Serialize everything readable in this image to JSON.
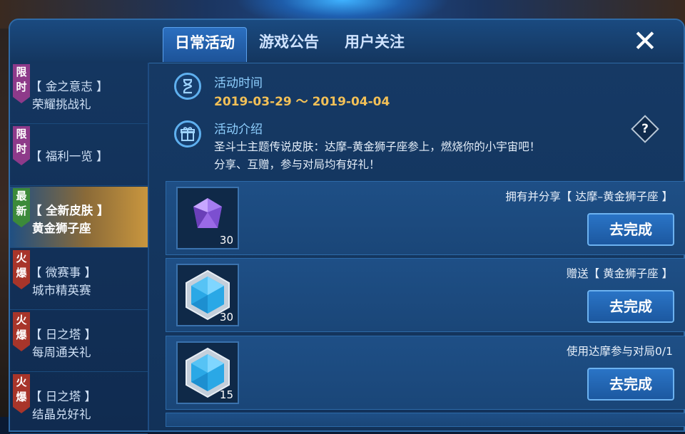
{
  "tabs": [
    {
      "label": "日常活动",
      "active": true
    },
    {
      "label": "游戏公告",
      "active": false
    },
    {
      "label": "用户关注",
      "active": false
    }
  ],
  "close": {
    "label": "✕"
  },
  "sidebar": {
    "items": [
      {
        "tag": "限时",
        "tag_color": "#8e3a8a",
        "line1": "【 金之意志 】",
        "line2": "荣耀挑战礼",
        "active": false
      },
      {
        "tag": "限时",
        "tag_color": "#8e3a8a",
        "line1": "【 福利一览 】",
        "line2": "",
        "active": false
      },
      {
        "tag": "最新",
        "tag_color": "#3c8a3a",
        "line1": "【 全新皮肤 】",
        "line2": "黄金狮子座",
        "active": true
      },
      {
        "tag": "火爆",
        "tag_color": "#a8352a",
        "line1": "【 微赛事 】",
        "line2": "城市精英赛",
        "active": false
      },
      {
        "tag": "火爆",
        "tag_color": "#a8352a",
        "line1": "【 日之塔 】",
        "line2": "每周通关礼",
        "active": false
      },
      {
        "tag": "火爆",
        "tag_color": "#a8352a",
        "line1": "【 日之塔 】",
        "line2": "结晶兑好礼",
        "active": false
      }
    ]
  },
  "activity": {
    "time_title": "活动时间",
    "time_range": "2019-03-29 ～ 2019-04-04",
    "intro_title": "活动介绍",
    "intro_line1": "圣斗士主题传说皮肤：达摩–黄金狮子座参上，燃烧你的小宇宙吧！",
    "intro_line2": "分享、互赠，参与对局均有好礼！",
    "help": "?"
  },
  "tasks": [
    {
      "desc": "拥有并分享【 达摩–黄金狮子座 】",
      "reward": "purple-diamond-icon",
      "count": "30",
      "button": "去完成"
    },
    {
      "desc": "赠送【 黄金狮子座 】",
      "reward": "blue-crystal-icon",
      "count": "30",
      "button": "去完成"
    },
    {
      "desc": "使用达摩参与对局0/1",
      "reward": "blue-crystal-icon",
      "count": "15",
      "button": "去完成"
    }
  ],
  "icons": {
    "time": "hourglass-icon",
    "intro": "gift-icon"
  },
  "colors": {
    "accent": "#f2c057",
    "title": "#8fd0ff",
    "panel": "#163a66"
  }
}
